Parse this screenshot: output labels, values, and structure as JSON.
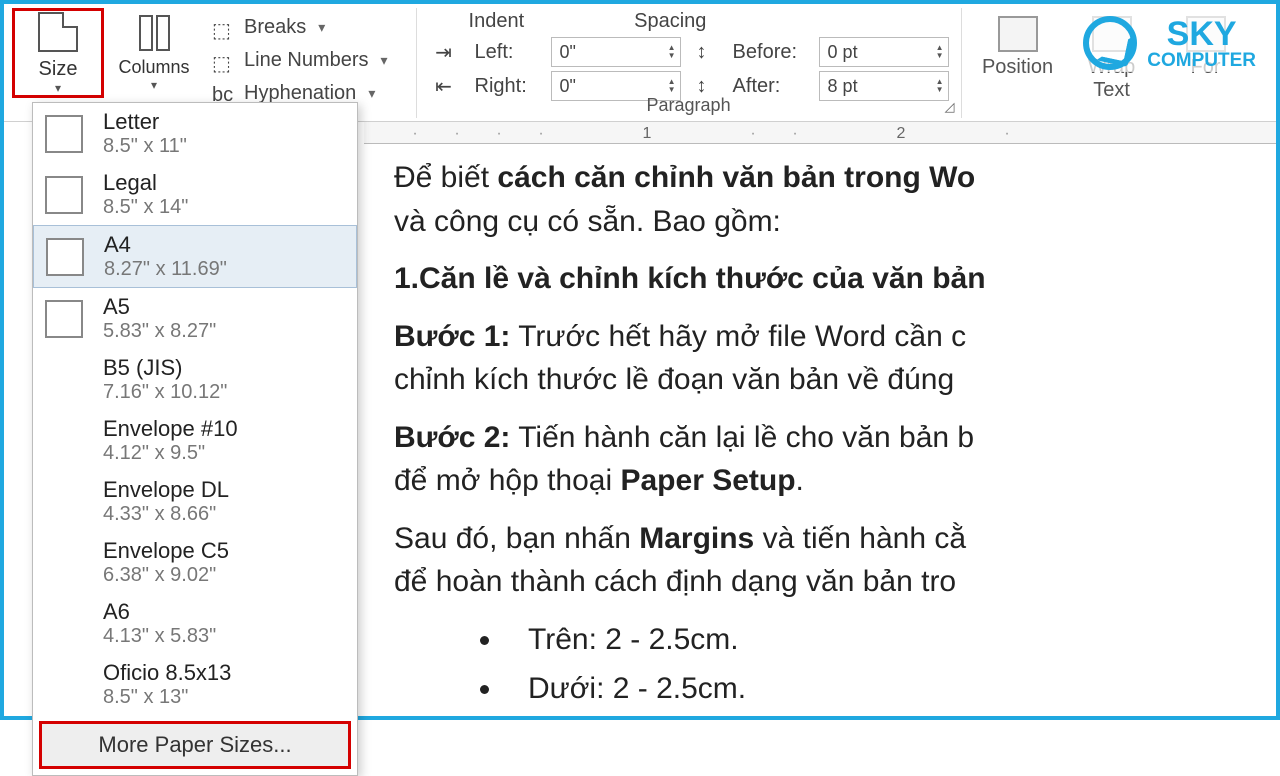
{
  "ribbon": {
    "size_label": "Size",
    "columns_label": "Columns",
    "breaks_label": "Breaks",
    "line_numbers_label": "Line Numbers",
    "hyphenation_label": "Hyphenation",
    "indent_title": "Indent",
    "spacing_title": "Spacing",
    "left_label": "Left:",
    "right_label": "Right:",
    "before_label": "Before:",
    "after_label": "After:",
    "left_value": "0\"",
    "right_value": "0\"",
    "before_value": "0 pt",
    "after_value": "8 pt",
    "paragraph_title": "Paragraph",
    "position_label": "Position",
    "wrap_label": "Wrap",
    "text_label": "Text",
    "for_label": "For"
  },
  "logo": {
    "line1": "SKY",
    "line2": "COMPUTER"
  },
  "size_menu": {
    "items": [
      {
        "name": "Letter",
        "dims": "8.5\" x 11\"",
        "icon": true,
        "selected": false
      },
      {
        "name": "Legal",
        "dims": "8.5\" x 14\"",
        "icon": true,
        "selected": false
      },
      {
        "name": "A4",
        "dims": "8.27\" x 11.69\"",
        "icon": true,
        "selected": true
      },
      {
        "name": "A5",
        "dims": "5.83\" x 8.27\"",
        "icon": true,
        "selected": false
      },
      {
        "name": "B5 (JIS)",
        "dims": "7.16\" x 10.12\"",
        "icon": false,
        "selected": false
      },
      {
        "name": "Envelope #10",
        "dims": "4.12\" x 9.5\"",
        "icon": false,
        "selected": false
      },
      {
        "name": "Envelope DL",
        "dims": "4.33\" x 8.66\"",
        "icon": false,
        "selected": false
      },
      {
        "name": "Envelope C5",
        "dims": "6.38\" x 9.02\"",
        "icon": false,
        "selected": false
      },
      {
        "name": "A6",
        "dims": "4.13\" x 5.83\"",
        "icon": false,
        "selected": false
      },
      {
        "name": "Oficio 8.5x13",
        "dims": "8.5\" x 13\"",
        "icon": false,
        "selected": false
      }
    ],
    "more_label": "More Paper Sizes..."
  },
  "ruler": {
    "m1": "1",
    "m2": "2"
  },
  "document": {
    "intro_pre": "Để biết ",
    "intro_bold": "cách căn chỉnh văn bản trong Wo",
    "intro_line2": "và công cụ có sẵn. Bao gồm:",
    "h1": "1.Căn lề và chỉnh kích thước của văn bản",
    "b1_label": "Bước 1:",
    "b1_text_a": " Trước hết hãy mở file Word cần c",
    "b1_text_b": "chỉnh kích thước lề đoạn văn bản về đúng",
    "b2_label": "Bước 2:",
    "b2_text_a": " Tiến hành căn lại lề cho văn bản b",
    "b2_text_b_pre": "để mở hộp thoại ",
    "b2_text_b_bold": "Paper Setup",
    "b2_text_b_post": ".",
    "p3_pre": "Sau đó, bạn nhấn ",
    "p3_bold": "Margins",
    "p3_post": " và tiến hành cằ",
    "p3_line2": "để hoàn thành cách định dạng văn bản tro",
    "li1": "Trên: 2 - 2.5cm.",
    "li2": "Dưới: 2 - 2.5cm."
  }
}
